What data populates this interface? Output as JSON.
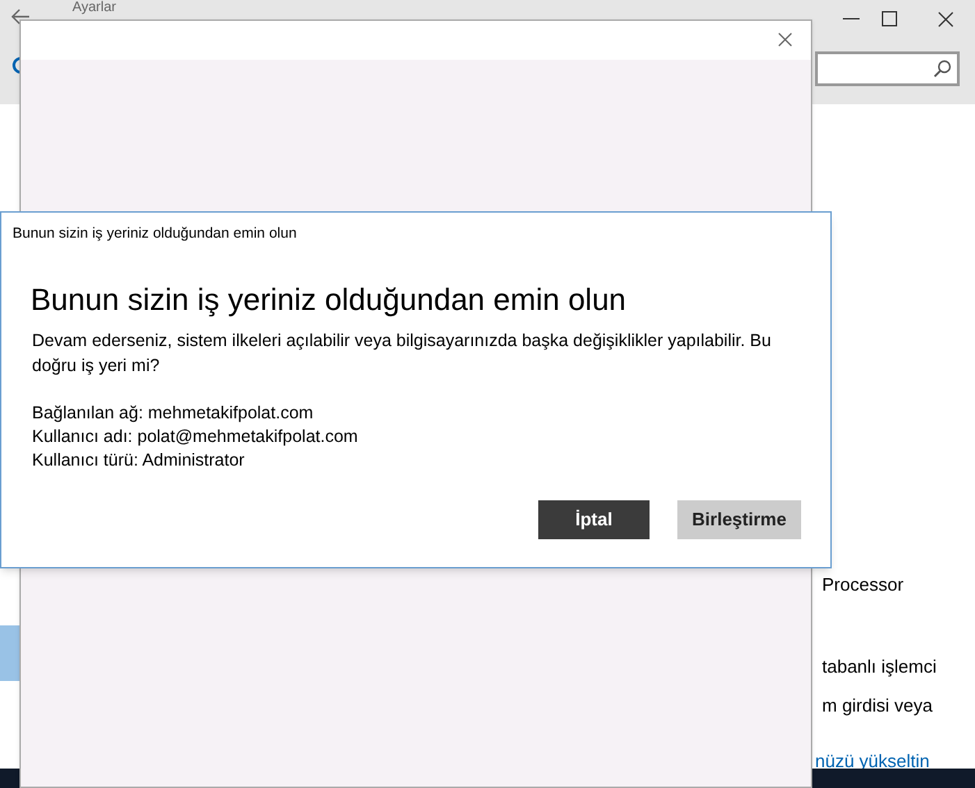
{
  "settings_window": {
    "title": "Ayarlar",
    "sidebar_items": [
      {
        "selected": true
      }
    ],
    "content_lines": [
      "Processor",
      "tabanlı işlemci",
      "m girdisi veya"
    ],
    "link": "nüzü yükseltin"
  },
  "dialog": {
    "caption": "Bunun sizin iş yeriniz olduğundan emin olun",
    "heading": "Bunun sizin iş yeriniz olduğundan emin olun",
    "message": "Devam ederseniz, sistem ilkeleri açılabilir veya bilgisayarınızda başka değişiklikler yapılabilir. Bu doğru iş yeri mi?",
    "details": [
      "Bağlanılan ağ: mehmetakifpolat.com",
      "Kullanıcı adı: polat@mehmetakifpolat.com",
      "Kullanıcı türü: Administrator"
    ],
    "buttons": [
      {
        "label": "İptal",
        "kind": "primary"
      },
      {
        "label": "Birleştirme",
        "kind": "secondary"
      }
    ]
  }
}
